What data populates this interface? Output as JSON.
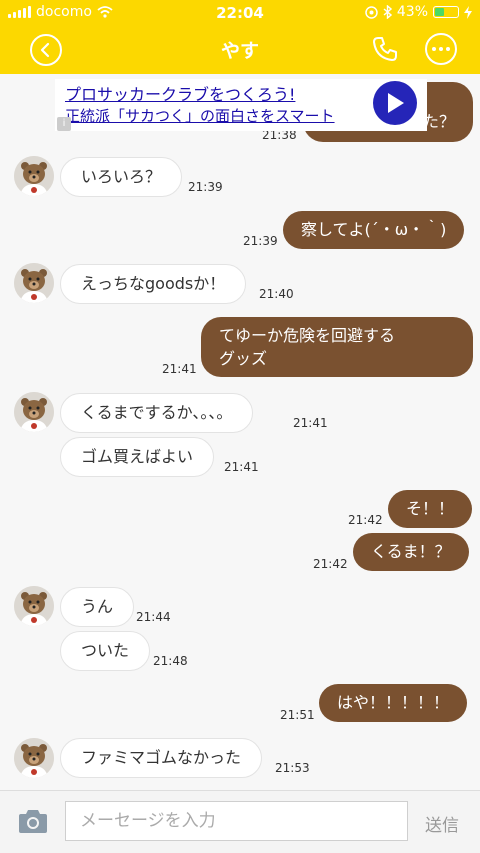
{
  "status_bar": {
    "carrier": "docomo",
    "time": "22:04",
    "battery": "43%",
    "battery_level": 0.43
  },
  "header": {
    "title": "やす"
  },
  "ad": {
    "line1": "プロサッカークラブをつくろう!",
    "line2": "正統派「サカつく」の面白さをスマート",
    "hidden_bubble_text": "た？",
    "hidden_time": "21:38"
  },
  "messages": [
    {
      "text": "いろいろ？",
      "time": "21:39"
    },
    {
      "text": "察してよ(´・ω・｀)",
      "time": "21:39"
    },
    {
      "text": "えっちなgoodsか！",
      "time": "21:40"
    },
    {
      "line1": "てゆーか危険を回避する",
      "line2": "グッズ",
      "time": "21:41"
    },
    {
      "text": "くるまでするか、。、。",
      "time": "21:41"
    },
    {
      "text": "ゴム買えばよい",
      "time": "21:41"
    },
    {
      "text": "そ！！",
      "time": "21:42"
    },
    {
      "text": "くるま！？",
      "time": "21:42"
    },
    {
      "text": "うん",
      "time": "21:44"
    },
    {
      "text": "ついた",
      "time": "21:48"
    },
    {
      "text": "はや！！！！！",
      "time": "21:51"
    },
    {
      "text": "ファミマゴムなかった",
      "time": "21:53"
    }
  ],
  "input": {
    "placeholder": "メーセージを入力",
    "send_label": "送信"
  },
  "colors": {
    "header": "#fcd800",
    "outgoing": "#7a5130",
    "incoming": "#ffffff"
  }
}
